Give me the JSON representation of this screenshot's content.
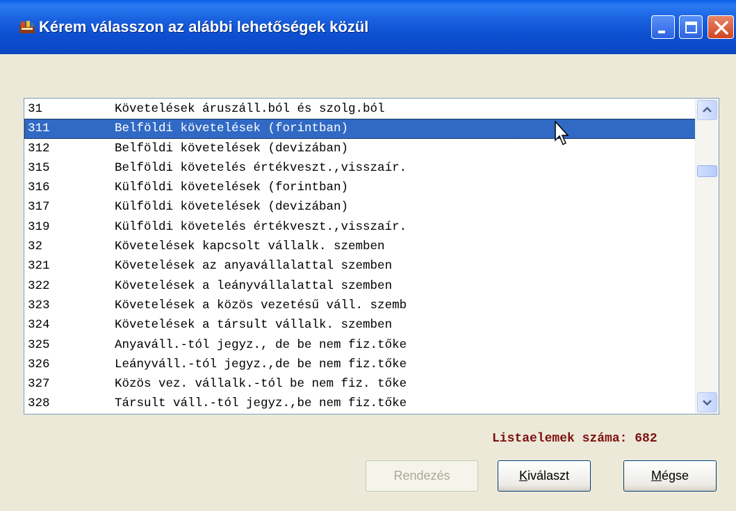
{
  "window": {
    "title": "Kérem válasszon az alábbi lehetőségek közül",
    "title_icon": "app-icon",
    "controls": [
      "minimize-icon",
      "maximize-icon",
      "close-icon"
    ]
  },
  "list": {
    "selected_index": 1,
    "items": [
      {
        "code": "31",
        "desc": "Követelések áruszáll.ból és szolg.ból"
      },
      {
        "code": "311",
        "desc": "Belföldi követelések (forintban)"
      },
      {
        "code": "312",
        "desc": "Belföldi követelések (devizában)"
      },
      {
        "code": "315",
        "desc": "Belföldi követelés értékveszt.,visszaír."
      },
      {
        "code": "316",
        "desc": "Külföldi követelések (forintban)"
      },
      {
        "code": "317",
        "desc": "Külföldi követelések (devizában)"
      },
      {
        "code": "319",
        "desc": "Külföldi követelés értékveszt.,visszaír."
      },
      {
        "code": "32",
        "desc": "Követelések kapcsolt vállalk. szemben"
      },
      {
        "code": "321",
        "desc": "Követelések az anyavállalattal szemben"
      },
      {
        "code": "322",
        "desc": "Követelések a leányvállalattal szemben"
      },
      {
        "code": "323",
        "desc": "Követelések a közös vezetésű váll. szemb"
      },
      {
        "code": "324",
        "desc": "Követelések a társult vállalk. szemben"
      },
      {
        "code": "325",
        "desc": "Anyaváll.-tól jegyz., de be nem fiz.tőke"
      },
      {
        "code": "326",
        "desc": "Leányváll.-tól jegyz.,de be nem fiz.tőke"
      },
      {
        "code": "327",
        "desc": "Közös vez. vállalk.-tól be nem fiz. tőke"
      },
      {
        "code": "328",
        "desc": "Társult váll.-tól jegyz.,be nem fiz.tőke"
      }
    ]
  },
  "status": {
    "count_label": "Listaelemek száma: 682"
  },
  "buttons": {
    "sort": {
      "label": "Rendezés",
      "enabled": false
    },
    "select": {
      "label_pre": "",
      "label_accel": "K",
      "label_post": "iválaszt"
    },
    "cancel": {
      "label_pre": "",
      "label_accel": "M",
      "label_post": "égse"
    }
  },
  "colors": {
    "selection": "#316AC5",
    "count_text": "#7E1010",
    "titlebar": "#0A48C3"
  }
}
